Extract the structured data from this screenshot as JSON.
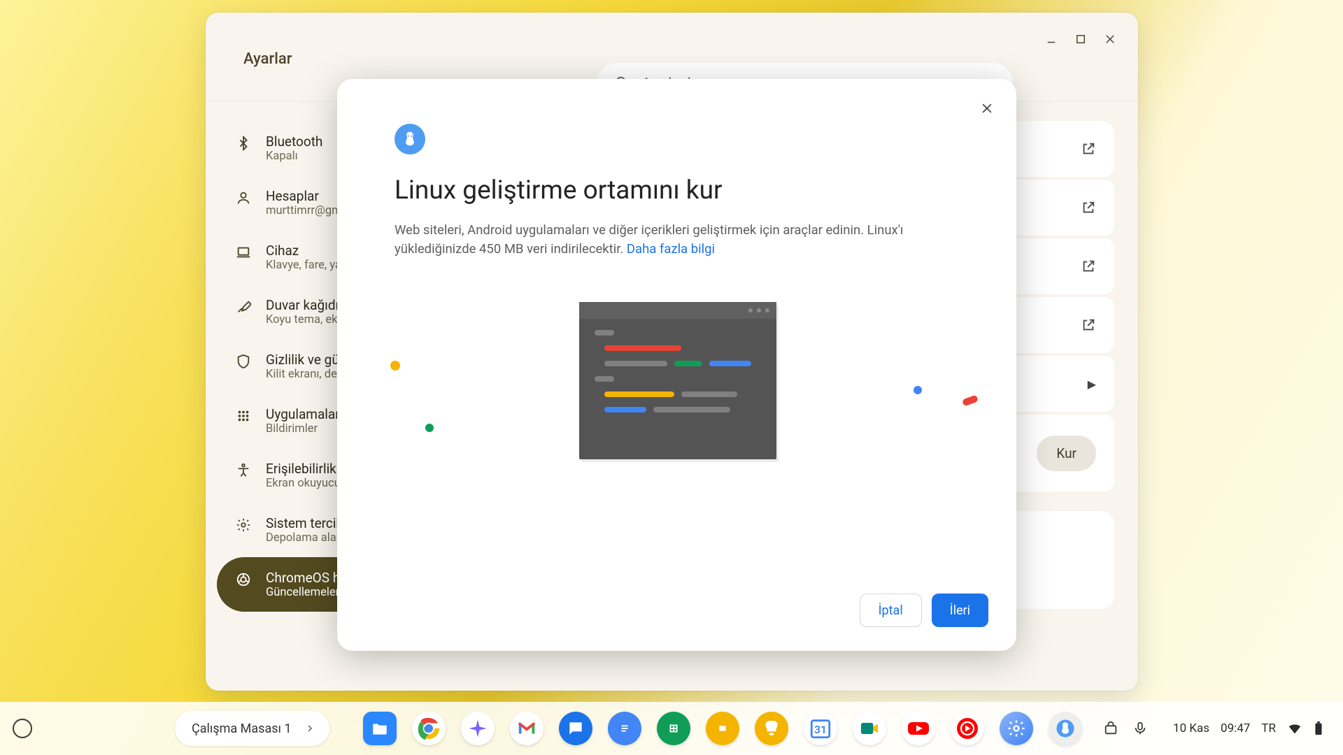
{
  "window": {
    "title": "Ayarlar"
  },
  "search": {
    "placeholder": "Ayarlarda ara"
  },
  "sidebar": {
    "items": [
      {
        "label": "Bluetooth",
        "sub": "Kapalı"
      },
      {
        "label": "Hesaplar",
        "sub": "murttimrr@gm..."
      },
      {
        "label": "Cihaz",
        "sub": "Klavye, fare, ya..."
      },
      {
        "label": "Duvar kağıdı",
        "sub": "Koyu tema, ekr..."
      },
      {
        "label": "Gizlilik ve güv...",
        "sub": "Kilit ekranı, der..."
      },
      {
        "label": "Uygulamalar",
        "sub": "Bildirimler"
      },
      {
        "label": "Erişilebilirlik",
        "sub": "Ekran okuyucu..."
      },
      {
        "label": "Sistem tercih...",
        "sub": "Depolama alan..."
      },
      {
        "label": "ChromeOS ha...",
        "sub": "Güncellemeler, ..."
      }
    ]
  },
  "content": {
    "install_button": "Kur"
  },
  "dialog": {
    "title": "Linux geliştirme ortamını kur",
    "body": "Web siteleri, Android uygulamaları ve diğer içerikleri geliştirmek için araçlar edinin. Linux'ı yüklediğinizde 450 MB veri indirilecektir. ",
    "more_link": "Daha fazla bilgi",
    "cancel": "İptal",
    "next": "İleri"
  },
  "shelf": {
    "desk_label": "Çalışma Masası 1",
    "date": "10 Kas",
    "time": "09:47",
    "lang": "TR"
  }
}
